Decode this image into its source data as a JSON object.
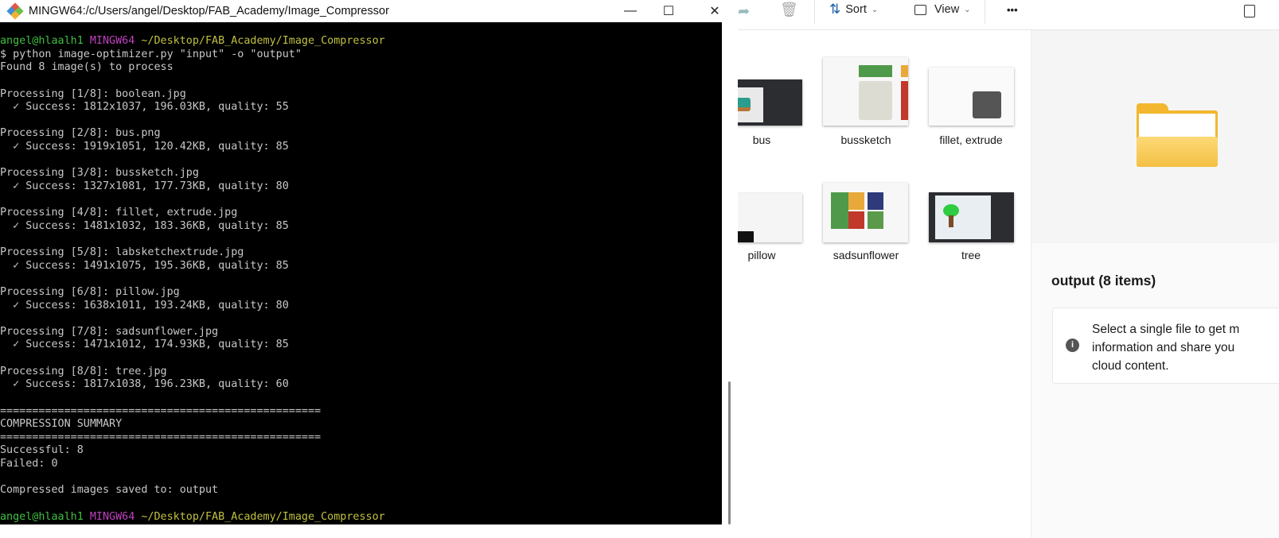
{
  "terminal": {
    "title": "MINGW64:/c/Users/angel/Desktop/FAB_Academy/Image_Compressor",
    "prompt": {
      "user": "angel@hlaalh1",
      "shell": "MINGW64",
      "path": "~/Desktop/FAB_Academy/Image_Compressor"
    },
    "lines": [
      "$ python image-optimizer.py \"input\" -o \"output\"",
      "Found 8 image(s) to process",
      "",
      "Processing [1/8]: boolean.jpg",
      "  ✓ Success: 1812x1037, 196.03KB, quality: 55",
      "",
      "Processing [2/8]: bus.png",
      "  ✓ Success: 1919x1051, 120.42KB, quality: 85",
      "",
      "Processing [3/8]: bussketch.jpg",
      "  ✓ Success: 1327x1081, 177.73KB, quality: 80",
      "",
      "Processing [4/8]: fillet, extrude.jpg",
      "  ✓ Success: 1481x1032, 183.36KB, quality: 85",
      "",
      "Processing [5/8]: labsketchextrude.jpg",
      "  ✓ Success: 1491x1075, 195.36KB, quality: 85",
      "",
      "Processing [6/8]: pillow.jpg",
      "  ✓ Success: 1638x1011, 193.24KB, quality: 80",
      "",
      "Processing [7/8]: sadsunflower.jpg",
      "  ✓ Success: 1471x1012, 174.93KB, quality: 85",
      "",
      "Processing [8/8]: tree.jpg",
      "  ✓ Success: 1817x1038, 196.23KB, quality: 60",
      "",
      "==================================================",
      "COMPRESSION SUMMARY",
      "==================================================",
      "Successful: 8",
      "Failed: 0",
      "",
      "Compressed images saved to: output",
      ""
    ],
    "buttons": {
      "minimize": "—",
      "maximize": "☐",
      "close": "✕"
    }
  },
  "explorer": {
    "toolbar": {
      "sort": "Sort",
      "view": "View",
      "more": "•••",
      "chevron": "⌄"
    },
    "files": [
      {
        "name": "bus"
      },
      {
        "name": "bussketch"
      },
      {
        "name": "fillet, extrude"
      },
      {
        "name": "pillow"
      },
      {
        "name": "sadsunflower"
      },
      {
        "name": "tree"
      }
    ],
    "details": {
      "title": "output (8 items)",
      "info_lines": [
        "Select a single file to get m",
        "information and share you",
        "cloud content."
      ]
    }
  }
}
